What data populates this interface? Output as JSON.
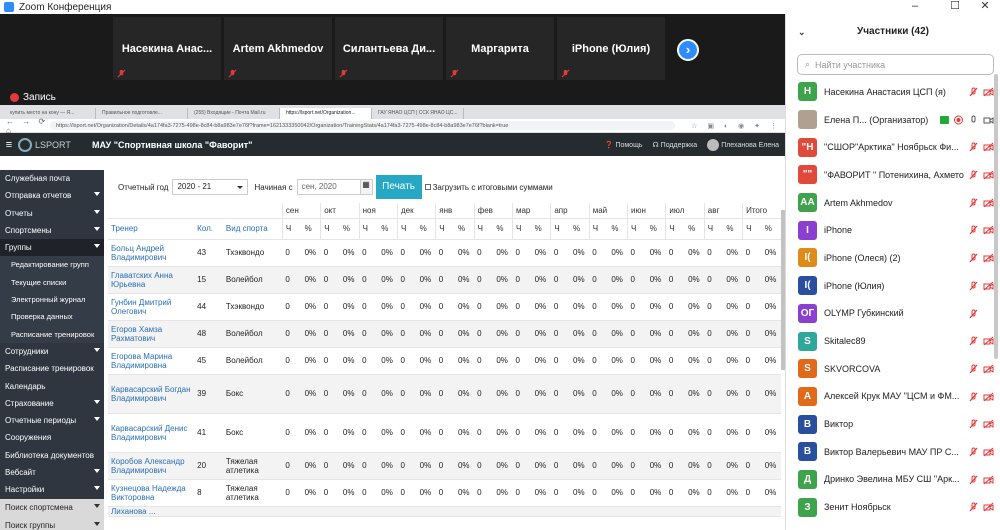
{
  "window": {
    "title": "Zoom Конференция",
    "controls": [
      "–",
      "☐",
      "✕"
    ]
  },
  "video_strip": {
    "tiles": [
      "Насекина Анас...",
      "Artem Akhmedov",
      "Силантьева Ди...",
      "Маргарита",
      "iPhone (Юлия)"
    ],
    "next_symbol": "›"
  },
  "recording": {
    "label": "Запись"
  },
  "browser": {
    "tabs": [
      "купить место на кону — Я...",
      "Правильное подготовле...",
      "(255) Входящие - Почта Mail.ru",
      "https://lsport.net/Organization...",
      "ГАУ ЯНАО ЦСП | ССК ЯНАО ЦС..."
    ],
    "nav_symbols": "← → ⟳ ⌂",
    "url": "https://lsport.net/Organization/Details/4a174fa3-7275-498e-8c84-b8a983e7e76f?frame=1621333350042/Organization/TrainingStats/4a174fa3-7275-498e-8c84-b8a983e7e76f?blank=true",
    "ext_symbols": "☆ ▣ ◐ ◉ ✦ ⋮"
  },
  "app": {
    "brand": "LSPORT",
    "org_name": "МАУ \"Спортивная школа \"Фаворит\"",
    "help": "Помощь",
    "support": "Поддержка",
    "user": "Плеханова Елена"
  },
  "sidenav": [
    {
      "label": "Служебная почта",
      "type": "main",
      "arrow": false
    },
    {
      "label": "Отправка отчетов",
      "type": "main",
      "arrow": true
    },
    {
      "label": "Отчеты",
      "type": "main",
      "arrow": true
    },
    {
      "label": "Спортсмены",
      "type": "main",
      "arrow": true
    },
    {
      "label": "Группы",
      "type": "active",
      "arrow": true
    },
    {
      "label": "Редактирование групп",
      "type": "sub",
      "arrow": false
    },
    {
      "label": "Текущие списки",
      "type": "sub",
      "arrow": false
    },
    {
      "label": "Электронный журнал",
      "type": "sub",
      "arrow": false
    },
    {
      "label": "Проверка данных",
      "type": "sub",
      "arrow": false
    },
    {
      "label": "Расписание тренировок",
      "type": "sub",
      "arrow": false
    },
    {
      "label": "Сотрудники",
      "type": "main",
      "arrow": true
    },
    {
      "label": "Расписание тренировок",
      "type": "main",
      "arrow": false
    },
    {
      "label": "Календарь",
      "type": "main",
      "arrow": false
    },
    {
      "label": "Страхование",
      "type": "main",
      "arrow": true
    },
    {
      "label": "Отчетные периоды",
      "type": "main",
      "arrow": true
    },
    {
      "label": "Сооружения",
      "type": "main",
      "arrow": false
    },
    {
      "label": "Библиотека документов",
      "type": "main",
      "arrow": false
    },
    {
      "label": "Вебсайт",
      "type": "main",
      "arrow": true
    },
    {
      "label": "Настройки",
      "type": "main",
      "arrow": true
    },
    {
      "label": "Поиск спортсмена",
      "type": "bot",
      "arrow": true
    },
    {
      "label": "Поиск группы",
      "type": "bot",
      "arrow": true
    }
  ],
  "filters": {
    "year_label": "Отчетный год",
    "year_value": "2020 - 21",
    "start_label": "Начиная с",
    "start_placeholder": "сен, 2020",
    "print_label": "Печать",
    "totals_label": "Загрузить с итоговыми суммами"
  },
  "table": {
    "col_trainer": "Тренер",
    "col_count": "Кол.",
    "col_sport": "Вид спорта",
    "months": [
      "сен",
      "окт",
      "ноя",
      "дек",
      "янв",
      "фев",
      "мар",
      "апр",
      "май",
      "июн",
      "июл",
      "авг",
      "Итого"
    ],
    "sub_h": "Ч",
    "sub_pct": "%",
    "rows": [
      {
        "trainer": "Больц Андрей Владимирович",
        "count": "43",
        "sport": "Тхэквондо"
      },
      {
        "trainer": "Главатских Анна Юрьевна",
        "count": "15",
        "sport": "Волейбол"
      },
      {
        "trainer": "Гунбин Дмитрий Олегович",
        "count": "44",
        "sport": "Тхэквондо"
      },
      {
        "trainer": "Егоров Хамза Рахматович",
        "count": "48",
        "sport": "Волейбол"
      },
      {
        "trainer": "Егорова Марина Владимировна",
        "count": "45",
        "sport": "Волейбол"
      },
      {
        "trainer": "Карвасарский Богдан Владимирович",
        "count": "39",
        "sport": "Бокс"
      },
      {
        "trainer": "Карвасарский Денис Владимирович",
        "count": "41",
        "sport": "Бокс"
      },
      {
        "trainer": "Коробов Александр Владимирович",
        "count": "20",
        "sport": "Тяжелая атлетика"
      },
      {
        "trainer": "Кузнецова Надежда Викторовна",
        "count": "8",
        "sport": "Тяжелая атлетика"
      },
      {
        "trainer": "Лиханова ...",
        "count": "",
        "sport": ""
      }
    ],
    "cell_h": "0",
    "cell_pct": "0%"
  },
  "participants": {
    "title": "Участники (42)",
    "search_placeholder": "Найти участника",
    "list": [
      {
        "initials": "Н",
        "color": "#3ea34a",
        "name": "Насекина Анастасия ЦСП (я)",
        "icons": "mutecam"
      },
      {
        "initials": "",
        "color": "#b0a090",
        "name": "Елена П... (Организатор)",
        "icons": "host"
      },
      {
        "initials": "\"Н",
        "color": "#e04a3a",
        "name": "\"СШОР\"Арктика\" Ноябрьск Фи...",
        "icons": "mutecam"
      },
      {
        "initials": "\"\"",
        "color": "#e04a3a",
        "name": "\"ФАВОРИТ \" Потенихина, Ахметов, ...",
        "icons": "mutecam"
      },
      {
        "initials": "AA",
        "color": "#3ea34a",
        "name": "Artem Akhmedov",
        "icons": "mutecam"
      },
      {
        "initials": "I",
        "color": "#8a3fd1",
        "name": "iPhone",
        "icons": "mutecam"
      },
      {
        "initials": "I(",
        "color": "#e08a1a",
        "name": "iPhone (Олеся) (2)",
        "icons": "mutecam"
      },
      {
        "initials": "I(",
        "color": "#2a4f9e",
        "name": "iPhone (Юлия)",
        "icons": "mutecam"
      },
      {
        "initials": "ОГ",
        "color": "#8a3fd1",
        "name": "OLYMP Губкинский",
        "icons": "mute"
      },
      {
        "initials": "S",
        "color": "#2fa89a",
        "name": "Skitalec89",
        "icons": "mutecam"
      },
      {
        "initials": "S",
        "color": "#e06a1a",
        "name": "SKVORCOVA",
        "icons": "mutecam"
      },
      {
        "initials": "А",
        "color": "#e06a1a",
        "name": "Алексей Крук МАУ \"ЦСМ и ФМ...",
        "icons": "mutecam"
      },
      {
        "initials": "В",
        "color": "#2a4f9e",
        "name": "Виктор",
        "icons": "mutecam"
      },
      {
        "initials": "В",
        "color": "#2a4f9e",
        "name": "Виктор Валерьевич МАУ ПР С...",
        "icons": "mutecam"
      },
      {
        "initials": "Д",
        "color": "#3ea34a",
        "name": "Дринко Эвелина МБУ СШ \"Арк...",
        "icons": "mutecam"
      },
      {
        "initials": "З",
        "color": "#3ea34a",
        "name": "Зенит Ноябрьск",
        "icons": "mutecam"
      }
    ]
  }
}
